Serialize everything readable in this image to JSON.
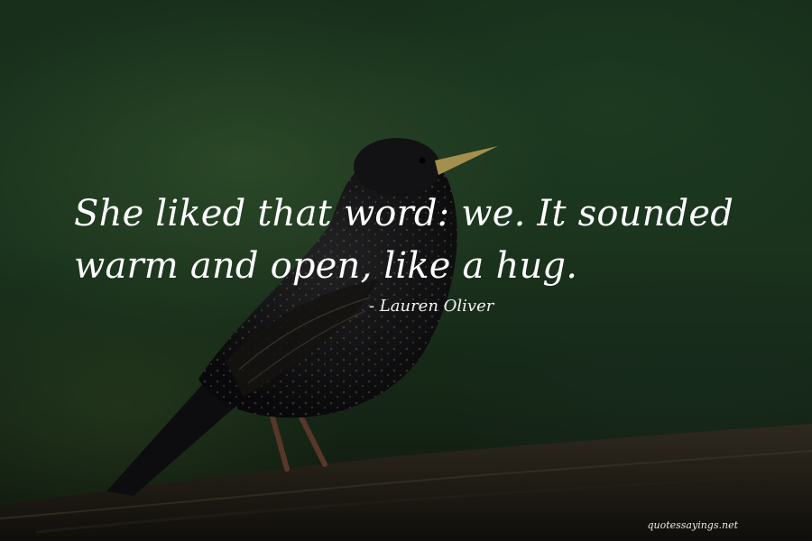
{
  "quote": {
    "text": "She liked that word: we. It sounded warm and open, like a hug.",
    "author": "- Lauren Oliver"
  },
  "watermark": "quotessayings.net"
}
